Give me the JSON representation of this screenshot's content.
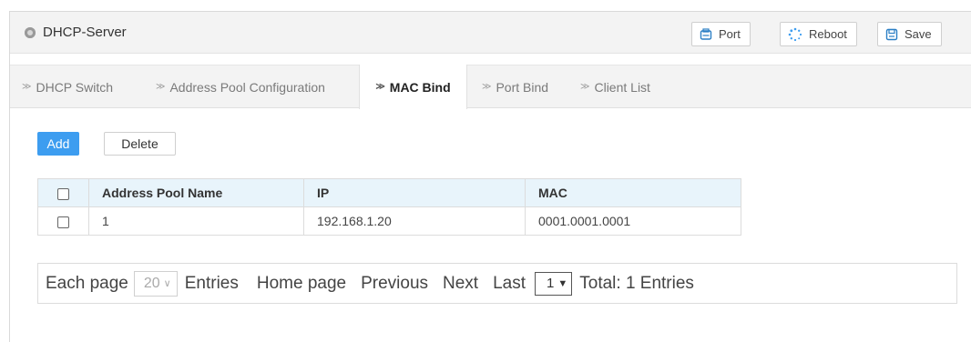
{
  "header": {
    "title": "DHCP-Server",
    "buttons": {
      "port": "Port",
      "reboot": "Reboot",
      "save": "Save"
    }
  },
  "tabs": [
    {
      "label": "DHCP Switch",
      "active": false
    },
    {
      "label": "Address Pool Configuration",
      "active": false
    },
    {
      "label": "MAC Bind",
      "active": true
    },
    {
      "label": "Port Bind",
      "active": false
    },
    {
      "label": "Client List",
      "active": false
    }
  ],
  "actions": {
    "add": "Add",
    "delete": "Delete"
  },
  "table": {
    "columns": [
      "Address Pool Name",
      "IP",
      "MAC"
    ],
    "rows": [
      {
        "pool": "1",
        "ip": "192.168.1.20",
        "mac": "0001.0001.0001"
      }
    ]
  },
  "pager": {
    "each_page": "Each page",
    "page_size": "20",
    "entries": "Entries",
    "home": "Home page",
    "previous": "Previous",
    "next": "Next",
    "last": "Last",
    "current_page": "1",
    "total": "Total: 1 Entries"
  },
  "colors": {
    "accent": "#3d9df0",
    "table_header_bg": "#e8f4fb",
    "panel_bg": "#f3f3f3"
  }
}
